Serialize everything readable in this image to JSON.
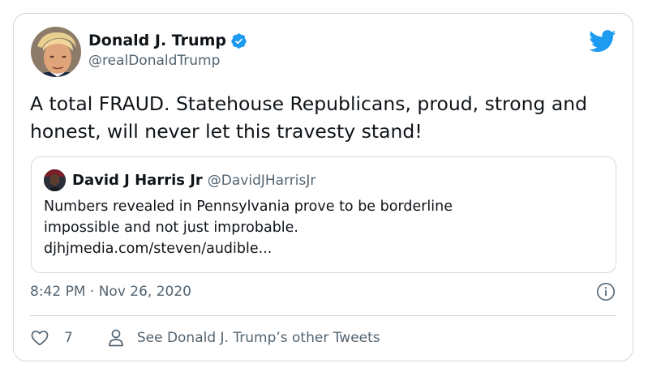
{
  "author": {
    "name": "Donald J. Trump",
    "handle": "@realDonaldTrump",
    "verified": true,
    "avatar_icon": "profile-photo"
  },
  "tweet": {
    "text": "A total FRAUD. Statehouse Republicans, proud, strong and honest, will never let this travesty stand!"
  },
  "quoted": {
    "name": "David J Harris Jr",
    "handle": "@DavidJHarrisJr",
    "lines": [
      "Numbers revealed in Pennsylvania prove to be borderline",
      "impossible and not just improbable.",
      "djhjmedia.com/steven/audible..."
    ]
  },
  "meta": {
    "timestamp": "8:42 PM · Nov 26, 2020"
  },
  "actions": {
    "like_count": "7",
    "other_tweets_label": "See Donald J. Trump’s other Tweets"
  },
  "colors": {
    "twitter_blue": "#1d9bf0",
    "text_primary": "#0f1419",
    "text_secondary": "#536471",
    "border": "#cfd9de"
  }
}
